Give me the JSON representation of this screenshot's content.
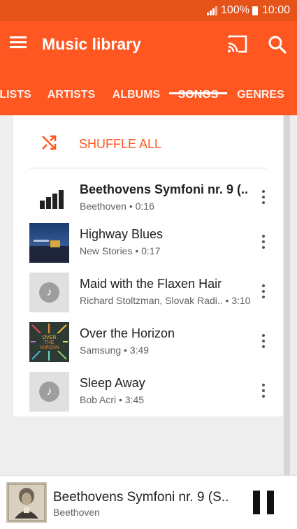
{
  "status_bar": {
    "battery": "100%",
    "time": "10:00"
  },
  "app_bar": {
    "title": "Music library"
  },
  "tabs": [
    "LISTS",
    "ARTISTS",
    "ALBUMS",
    "SONGS",
    "GENRES"
  ],
  "active_tab": "SONGS",
  "shuffle": {
    "label": "SHUFFLE ALL"
  },
  "songs": [
    {
      "title": "Beethovens Symfoni nr. 9 (..",
      "subtitle": "Beethoven • 0:16",
      "playing": true
    },
    {
      "title": "Highway Blues",
      "subtitle": "New Stories • 0:17"
    },
    {
      "title": "Maid with the Flaxen Hair",
      "subtitle": "Richard Stoltzman, Slovak Radi..  • 3:10"
    },
    {
      "title": "Over the Horizon",
      "subtitle": "Samsung • 3:49",
      "art_text": "OVER THE HORIZON"
    },
    {
      "title": "Sleep Away",
      "subtitle": "Bob Acri • 3:45"
    }
  ],
  "now_playing": {
    "title": "Beethovens Symfoni nr. 9 (S..",
    "artist": "Beethoven"
  },
  "colors": {
    "accent": "#ff5722",
    "status_bar": "#e5521a"
  },
  "icons": [
    "menu-icon",
    "cast-icon",
    "search-icon",
    "shuffle-icon",
    "equalizer-icon",
    "music-note-icon",
    "more-vert-icon",
    "pause-icon"
  ]
}
